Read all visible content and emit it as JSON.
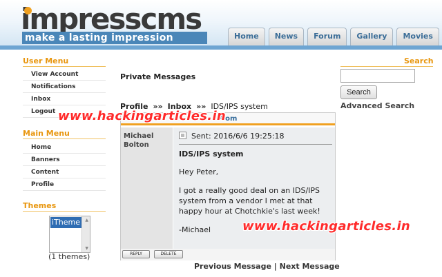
{
  "brand": {
    "logo_word_left": "impress",
    "logo_word_right": "cms",
    "tagline": "make a lasting impression"
  },
  "nav": {
    "tabs": [
      "Home",
      "News",
      "Forum",
      "Gallery",
      "Movies"
    ]
  },
  "user_menu": {
    "title": "User Menu",
    "items": [
      "View Account",
      "Notifications",
      "Inbox",
      "Logout"
    ]
  },
  "main_menu": {
    "title": "Main Menu",
    "items": [
      "Home",
      "Banners",
      "Content",
      "Profile"
    ]
  },
  "themes": {
    "title": "Themes",
    "selected": "iTheme",
    "count_label": "(1 themes)"
  },
  "search": {
    "title": "Search",
    "input_value": "",
    "button_label": "Search",
    "advanced_label": "Advanced Search"
  },
  "page": {
    "title": "Private Messages",
    "breadcrumb": {
      "profile": "Profile",
      "sep": "»»",
      "inbox": "Inbox",
      "current": "IDS/IPS system"
    }
  },
  "message": {
    "from_header": "From",
    "sender": "Michael Bolton",
    "sent": "Sent: 2016/6/6 19:25:18",
    "subject": "IDS/IPS system",
    "greeting": "Hey Peter,",
    "body": "I got a really good deal on an IDS/IPS system from a vendor I met at that happy hour at Chotchkie's last week!",
    "signoff": "-Michael",
    "reply_label": "REPLY",
    "delete_label": "DELETE"
  },
  "pager": {
    "previous": "Previous Message",
    "divider": "|",
    "next": "Next Message"
  },
  "watermark": {
    "text": "www.hackingarticles.in"
  },
  "colors": {
    "accent_orange": "#f0a020",
    "brand_blue": "#4a86b8",
    "watermark_red": "#ff2b2b"
  }
}
